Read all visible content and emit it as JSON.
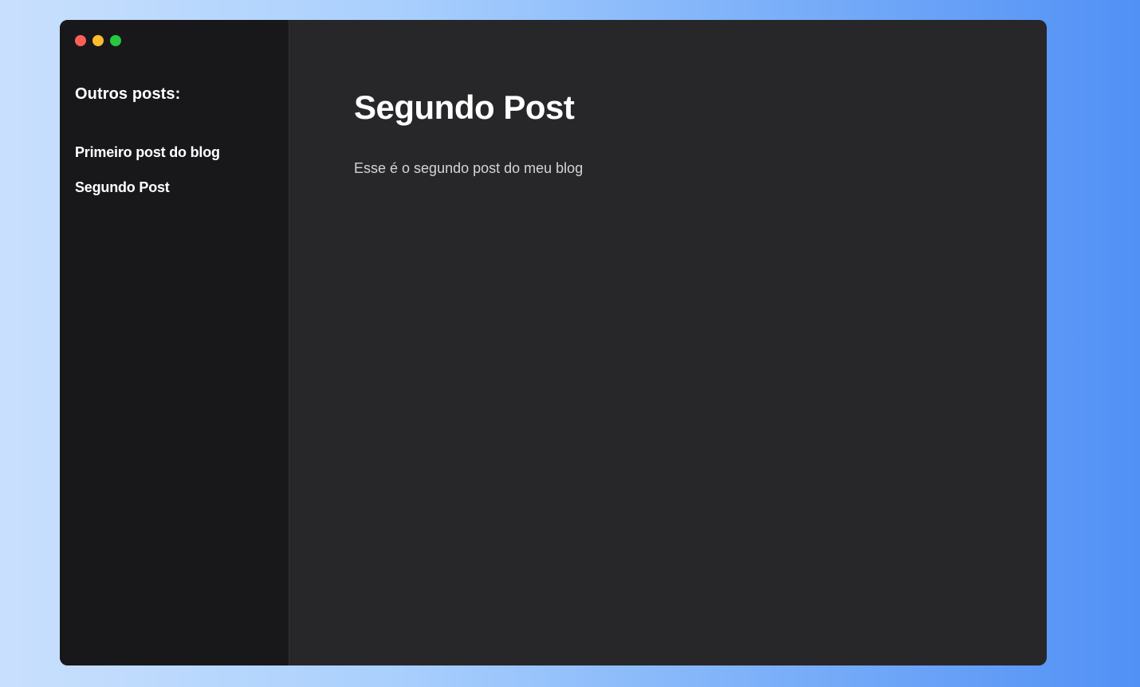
{
  "window": {
    "controls": [
      {
        "name": "close",
        "color": "#ff5f57"
      },
      {
        "name": "minimize",
        "color": "#febc2e"
      },
      {
        "name": "maximize",
        "color": "#28c840"
      }
    ]
  },
  "sidebar": {
    "title": "Outros posts:",
    "posts": [
      {
        "label": "Primeiro post do blog"
      },
      {
        "label": "Segundo Post"
      }
    ]
  },
  "main": {
    "title": "Segundo Post",
    "body": "Esse é o segundo post do meu blog"
  },
  "colors": {
    "sidebar_bg": "#18181b",
    "main_bg": "#27272a",
    "text_primary": "#ffffff",
    "text_secondary": "#d4d4d8"
  }
}
